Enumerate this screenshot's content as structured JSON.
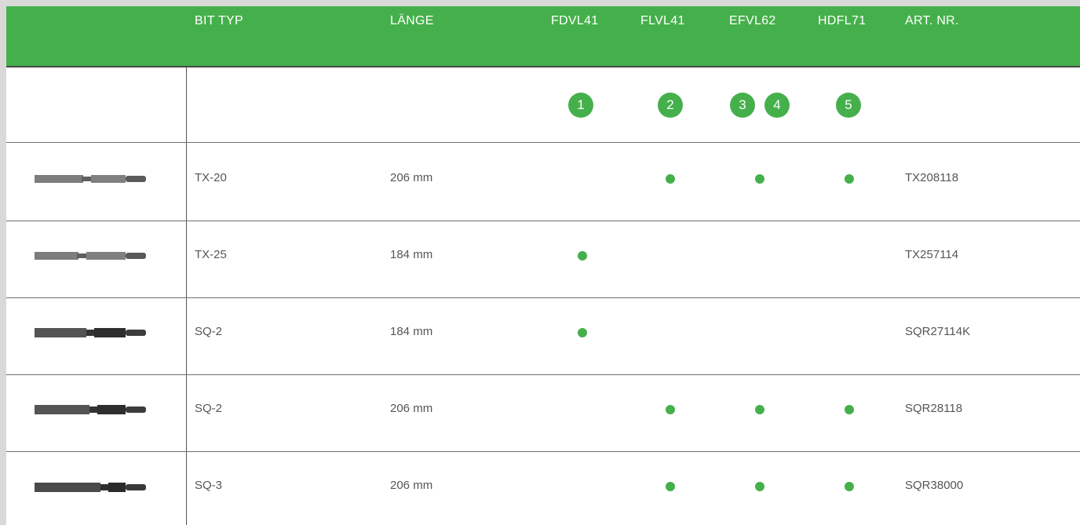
{
  "header": {
    "bit_typ": "BIT TYP",
    "laenge": "LÄNGE",
    "fdvl41": "FDVL41",
    "flvl41": "FLVL41",
    "efvl62": "EFVL62",
    "hdfl71": "HDFL71",
    "art_nr": "ART. NR."
  },
  "numbers": [
    "1",
    "2",
    "3",
    "4",
    "5"
  ],
  "colors": {
    "accent": "#45b04b",
    "rule": "#6e6e6e"
  },
  "rows": [
    {
      "typ": "TX-20",
      "laenge": "206 mm",
      "fdvl41": false,
      "flvl41": true,
      "efvl62": true,
      "hdfl71": true,
      "art": "TX208118"
    },
    {
      "typ": "TX-25",
      "laenge": "184 mm",
      "fdvl41": true,
      "flvl41": false,
      "efvl62": false,
      "hdfl71": false,
      "art": "TX257114"
    },
    {
      "typ": "SQ-2",
      "laenge": "184 mm",
      "fdvl41": true,
      "flvl41": false,
      "efvl62": false,
      "hdfl71": false,
      "art": "SQR27114K"
    },
    {
      "typ": "SQ-2",
      "laenge": "206 mm",
      "fdvl41": false,
      "flvl41": true,
      "efvl62": true,
      "hdfl71": true,
      "art": "SQR28118"
    },
    {
      "typ": "SQ-3",
      "laenge": "206 mm",
      "fdvl41": false,
      "flvl41": true,
      "efvl62": true,
      "hdfl71": true,
      "art": "SQR38000"
    }
  ]
}
